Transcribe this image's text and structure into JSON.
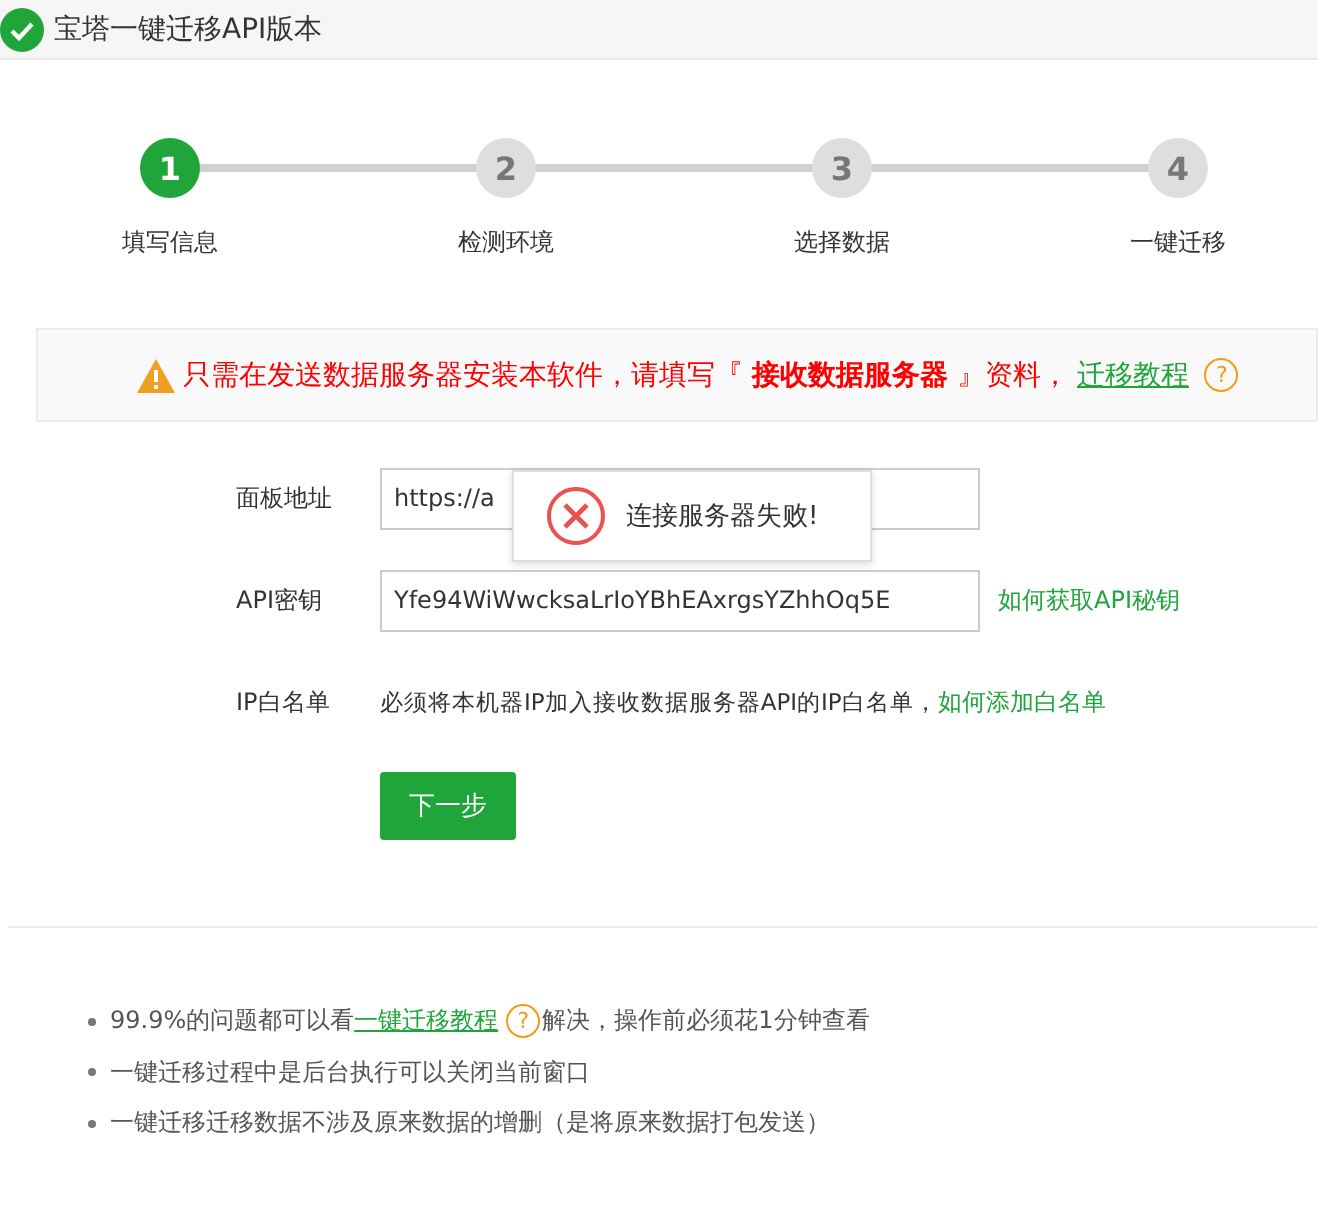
{
  "window": {
    "title": "宝塔一键迁移API版本"
  },
  "steps": [
    {
      "number": "1",
      "label": "填写信息",
      "selected": true
    },
    {
      "number": "2",
      "label": "检测环境",
      "selected": false
    },
    {
      "number": "3",
      "label": "选择数据",
      "selected": false
    },
    {
      "number": "4",
      "label": "一键迁移",
      "selected": false
    }
  ],
  "notice": {
    "text": "只需在发送数据服务器安装本软件，请填写『 **接收数据服务器** 』资料，",
    "link": "迁移教程",
    "help": "?"
  },
  "form": {
    "panel_url": {
      "label": "面板地址",
      "value": "https://a"
    },
    "api_key": {
      "label": "API密钥",
      "value": "Yfe94WiWwcksaLrIoYBhEAxrgsYZhhOq5E",
      "link": "如何获取API秘钥"
    },
    "ip_whitelist": {
      "label": "IP白名单",
      "text": "必须将本机器IP加入接收数据服务器API的IP白名单，",
      "link": "如何添加白名单"
    },
    "next_button": "下一步"
  },
  "toast": {
    "message": "连接服务器失败!"
  },
  "tips": [
    {
      "kind": "link",
      "before": "99.9%的问题都可以看",
      "link": "一键迁移教程",
      "help": "?",
      "after": "解决，操作前必须花1分钟查看"
    },
    {
      "kind": "plain",
      "text": "一键迁移过程中是后台执行可以关闭当前窗口"
    },
    {
      "kind": "plain",
      "text": "一键迁移迁移数据不涉及原来数据的增删（是将原来数据打包发送）"
    }
  ]
}
